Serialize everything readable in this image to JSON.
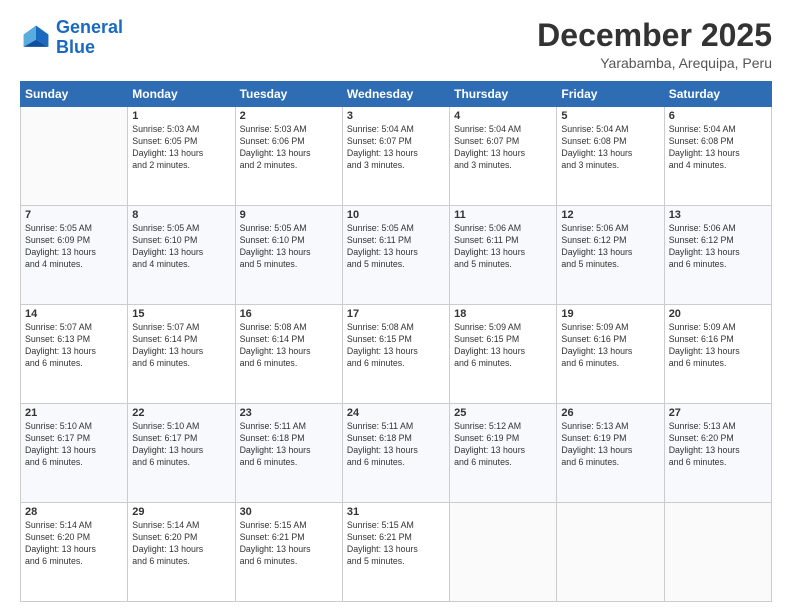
{
  "logo": {
    "line1": "General",
    "line2": "Blue"
  },
  "title": "December 2025",
  "subtitle": "Yarabamba, Arequipa, Peru",
  "weekdays": [
    "Sunday",
    "Monday",
    "Tuesday",
    "Wednesday",
    "Thursday",
    "Friday",
    "Saturday"
  ],
  "weeks": [
    [
      {
        "day": "",
        "info": ""
      },
      {
        "day": "1",
        "info": "Sunrise: 5:03 AM\nSunset: 6:05 PM\nDaylight: 13 hours\nand 2 minutes."
      },
      {
        "day": "2",
        "info": "Sunrise: 5:03 AM\nSunset: 6:06 PM\nDaylight: 13 hours\nand 2 minutes."
      },
      {
        "day": "3",
        "info": "Sunrise: 5:04 AM\nSunset: 6:07 PM\nDaylight: 13 hours\nand 3 minutes."
      },
      {
        "day": "4",
        "info": "Sunrise: 5:04 AM\nSunset: 6:07 PM\nDaylight: 13 hours\nand 3 minutes."
      },
      {
        "day": "5",
        "info": "Sunrise: 5:04 AM\nSunset: 6:08 PM\nDaylight: 13 hours\nand 3 minutes."
      },
      {
        "day": "6",
        "info": "Sunrise: 5:04 AM\nSunset: 6:08 PM\nDaylight: 13 hours\nand 4 minutes."
      }
    ],
    [
      {
        "day": "7",
        "info": "Sunrise: 5:05 AM\nSunset: 6:09 PM\nDaylight: 13 hours\nand 4 minutes."
      },
      {
        "day": "8",
        "info": "Sunrise: 5:05 AM\nSunset: 6:10 PM\nDaylight: 13 hours\nand 4 minutes."
      },
      {
        "day": "9",
        "info": "Sunrise: 5:05 AM\nSunset: 6:10 PM\nDaylight: 13 hours\nand 5 minutes."
      },
      {
        "day": "10",
        "info": "Sunrise: 5:05 AM\nSunset: 6:11 PM\nDaylight: 13 hours\nand 5 minutes."
      },
      {
        "day": "11",
        "info": "Sunrise: 5:06 AM\nSunset: 6:11 PM\nDaylight: 13 hours\nand 5 minutes."
      },
      {
        "day": "12",
        "info": "Sunrise: 5:06 AM\nSunset: 6:12 PM\nDaylight: 13 hours\nand 5 minutes."
      },
      {
        "day": "13",
        "info": "Sunrise: 5:06 AM\nSunset: 6:12 PM\nDaylight: 13 hours\nand 6 minutes."
      }
    ],
    [
      {
        "day": "14",
        "info": "Sunrise: 5:07 AM\nSunset: 6:13 PM\nDaylight: 13 hours\nand 6 minutes."
      },
      {
        "day": "15",
        "info": "Sunrise: 5:07 AM\nSunset: 6:14 PM\nDaylight: 13 hours\nand 6 minutes."
      },
      {
        "day": "16",
        "info": "Sunrise: 5:08 AM\nSunset: 6:14 PM\nDaylight: 13 hours\nand 6 minutes."
      },
      {
        "day": "17",
        "info": "Sunrise: 5:08 AM\nSunset: 6:15 PM\nDaylight: 13 hours\nand 6 minutes."
      },
      {
        "day": "18",
        "info": "Sunrise: 5:09 AM\nSunset: 6:15 PM\nDaylight: 13 hours\nand 6 minutes."
      },
      {
        "day": "19",
        "info": "Sunrise: 5:09 AM\nSunset: 6:16 PM\nDaylight: 13 hours\nand 6 minutes."
      },
      {
        "day": "20",
        "info": "Sunrise: 5:09 AM\nSunset: 6:16 PM\nDaylight: 13 hours\nand 6 minutes."
      }
    ],
    [
      {
        "day": "21",
        "info": "Sunrise: 5:10 AM\nSunset: 6:17 PM\nDaylight: 13 hours\nand 6 minutes."
      },
      {
        "day": "22",
        "info": "Sunrise: 5:10 AM\nSunset: 6:17 PM\nDaylight: 13 hours\nand 6 minutes."
      },
      {
        "day": "23",
        "info": "Sunrise: 5:11 AM\nSunset: 6:18 PM\nDaylight: 13 hours\nand 6 minutes."
      },
      {
        "day": "24",
        "info": "Sunrise: 5:11 AM\nSunset: 6:18 PM\nDaylight: 13 hours\nand 6 minutes."
      },
      {
        "day": "25",
        "info": "Sunrise: 5:12 AM\nSunset: 6:19 PM\nDaylight: 13 hours\nand 6 minutes."
      },
      {
        "day": "26",
        "info": "Sunrise: 5:13 AM\nSunset: 6:19 PM\nDaylight: 13 hours\nand 6 minutes."
      },
      {
        "day": "27",
        "info": "Sunrise: 5:13 AM\nSunset: 6:20 PM\nDaylight: 13 hours\nand 6 minutes."
      }
    ],
    [
      {
        "day": "28",
        "info": "Sunrise: 5:14 AM\nSunset: 6:20 PM\nDaylight: 13 hours\nand 6 minutes."
      },
      {
        "day": "29",
        "info": "Sunrise: 5:14 AM\nSunset: 6:20 PM\nDaylight: 13 hours\nand 6 minutes."
      },
      {
        "day": "30",
        "info": "Sunrise: 5:15 AM\nSunset: 6:21 PM\nDaylight: 13 hours\nand 6 minutes."
      },
      {
        "day": "31",
        "info": "Sunrise: 5:15 AM\nSunset: 6:21 PM\nDaylight: 13 hours\nand 5 minutes."
      },
      {
        "day": "",
        "info": ""
      },
      {
        "day": "",
        "info": ""
      },
      {
        "day": "",
        "info": ""
      }
    ]
  ]
}
